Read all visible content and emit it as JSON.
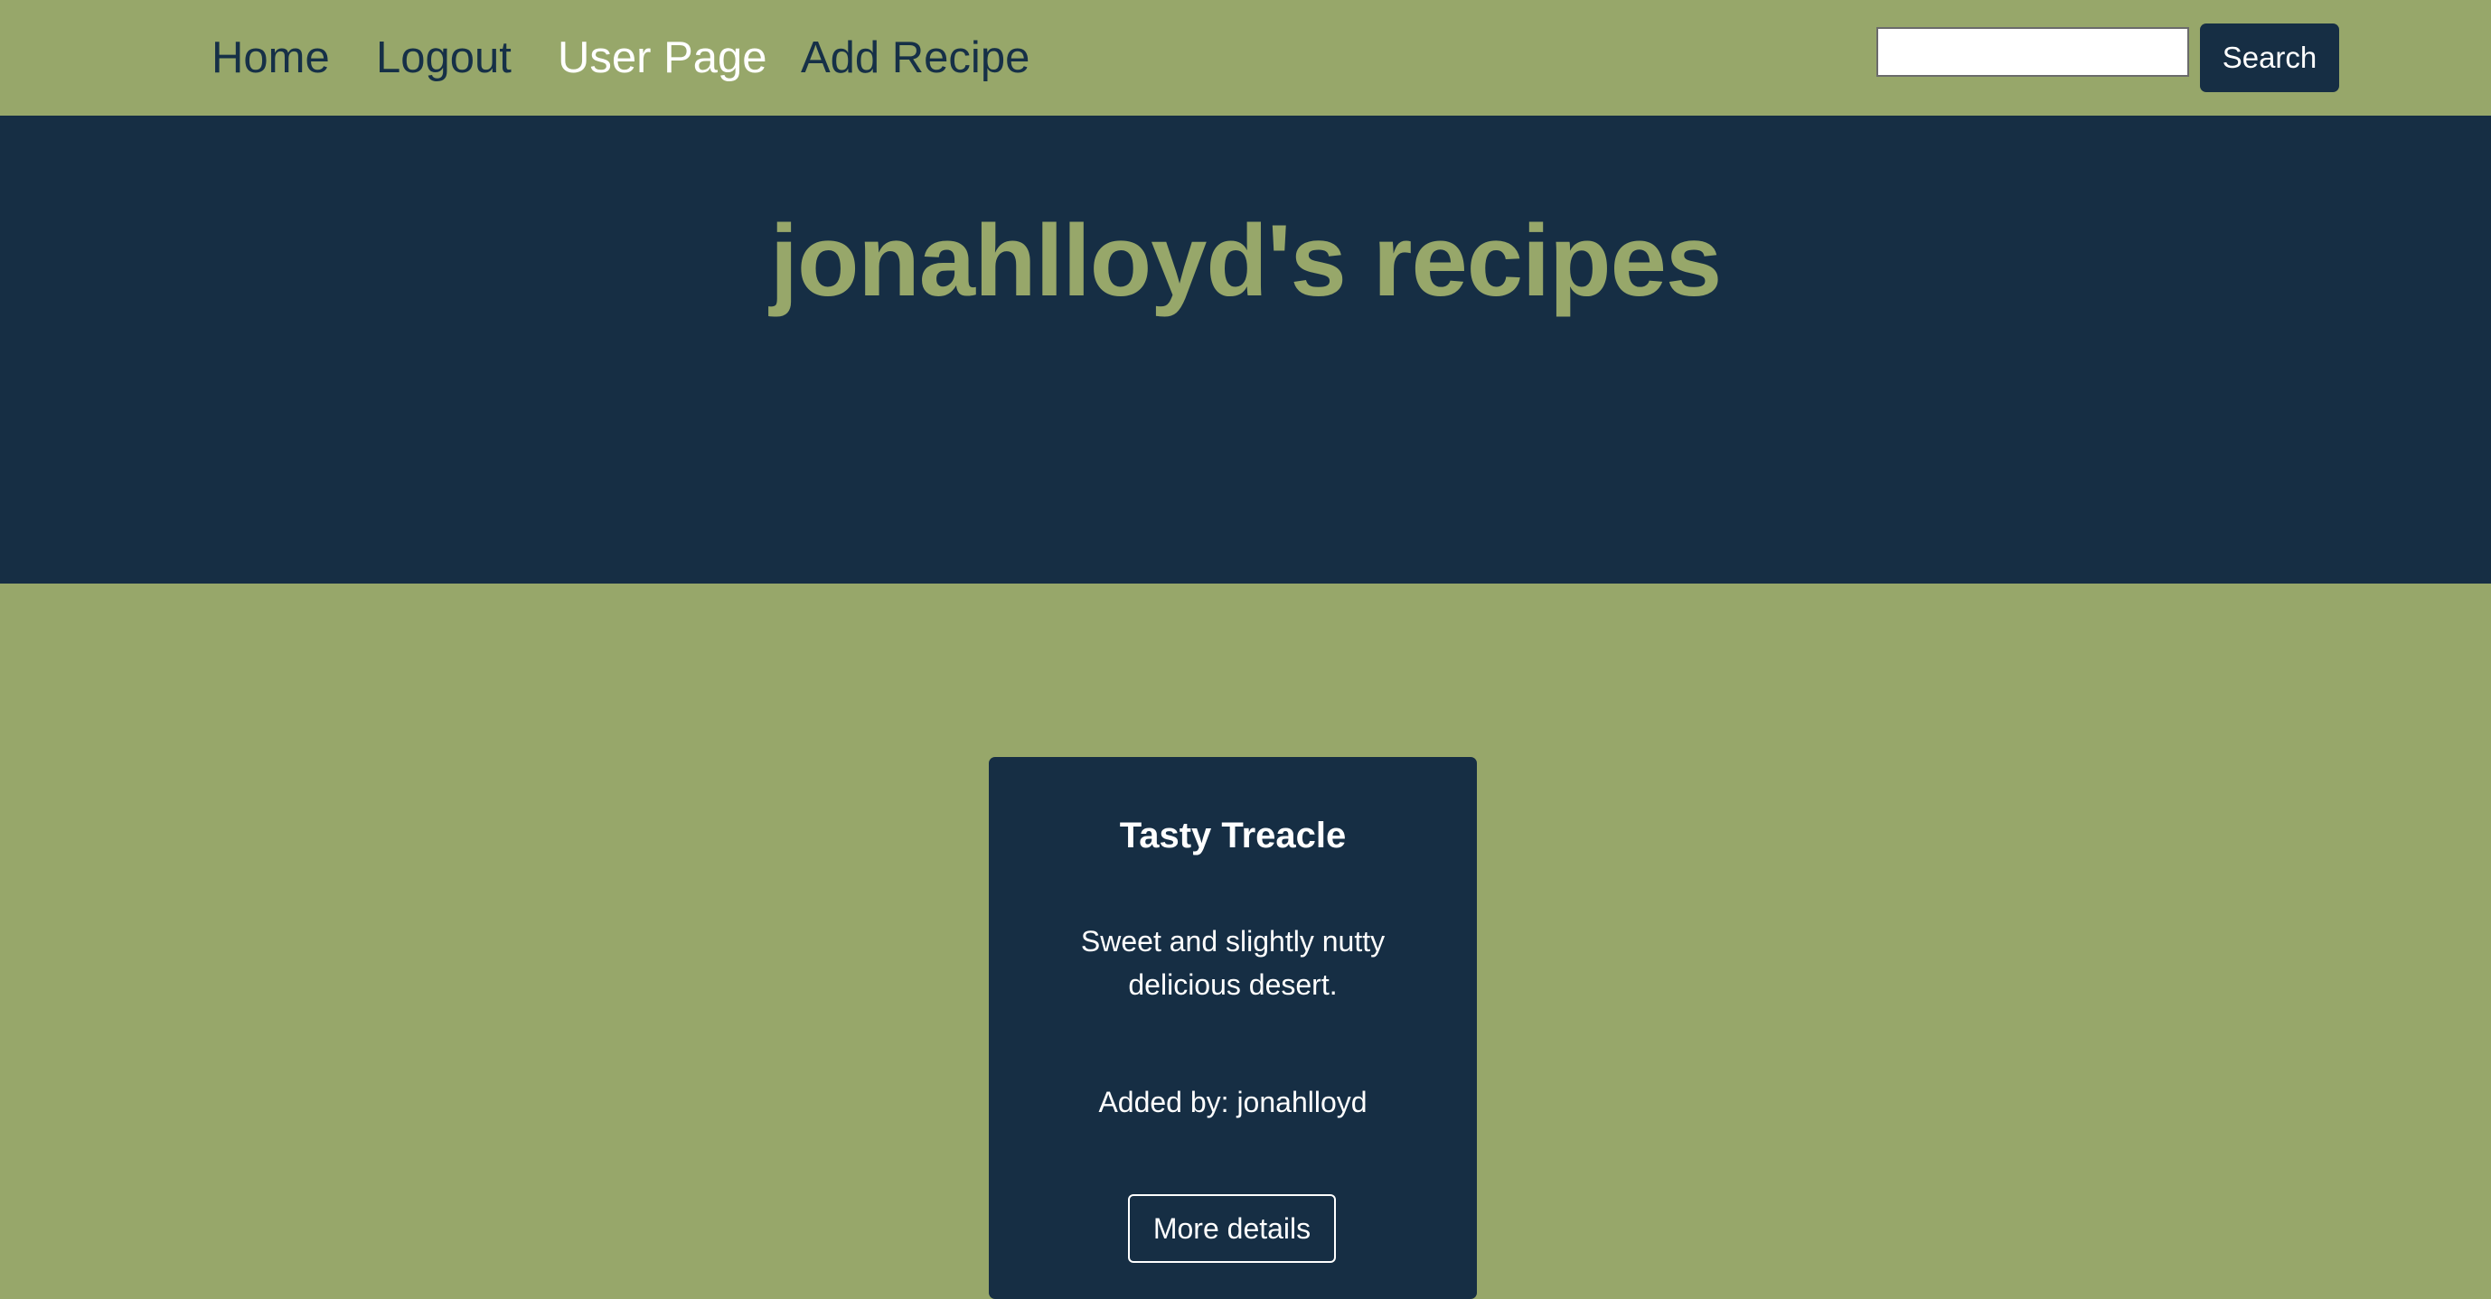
{
  "nav": {
    "links": [
      {
        "label": "Home"
      },
      {
        "label": "Logout"
      },
      {
        "label": "User Page"
      },
      {
        "label": "Add Recipe"
      }
    ],
    "search": {
      "value": "",
      "placeholder": ""
    },
    "search_button_label": "Search"
  },
  "hero": {
    "title": "jonahlloyd's recipes"
  },
  "recipes": [
    {
      "title": "Tasty Treacle",
      "description": "Sweet and slightly nutty delicious desert.",
      "added_by": "Added by: jonahlloyd",
      "button_label": "More details"
    }
  ],
  "colors": {
    "background": "#97a76a",
    "dark": "#162e44",
    "text_light": "#ffffff"
  }
}
